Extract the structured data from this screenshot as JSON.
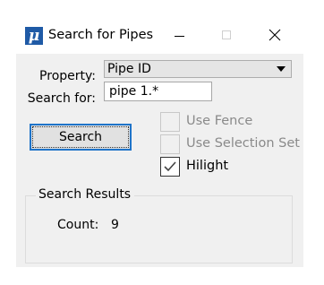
{
  "window": {
    "title": "Search for Pipes",
    "icon": "microstation-mu-icon",
    "icon_glyph": "μ"
  },
  "form": {
    "property_label": "Property:",
    "property_value": "Pipe ID",
    "search_label": "Search for:",
    "search_value": "pipe 1.*"
  },
  "buttons": {
    "search_label": "Search"
  },
  "options": {
    "use_fence": {
      "label": "Use Fence",
      "checked": false,
      "enabled": false
    },
    "use_selection_set": {
      "label": "Use Selection Set",
      "checked": false,
      "enabled": false
    },
    "hilight": {
      "label": "Hilight",
      "checked": true,
      "enabled": true
    }
  },
  "results": {
    "title": "Search Results",
    "count_label": "Count:",
    "count_value": "9"
  },
  "colors": {
    "focus_border": "#1f74c9",
    "window_bg": "#f0f0f0",
    "icon_bg": "#1f5aa6"
  }
}
